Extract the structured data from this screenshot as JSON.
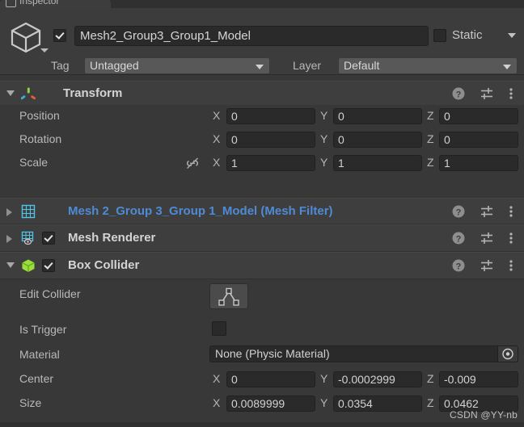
{
  "window": {
    "tab_label": "Inspector",
    "tab_icon": "inspector-icon"
  },
  "header": {
    "object_icon": "gameobject-cube-icon",
    "enabled_checkbox": true,
    "name": "Mesh2_Group3_Group1_Model",
    "static_label": "Static",
    "static_checked": false,
    "static_dropdown_icon": "chevron-down-icon",
    "tag_label": "Tag",
    "tag_value": "Untagged",
    "layer_label": "Layer",
    "layer_value": "Default"
  },
  "components": [
    {
      "name": "Transform",
      "icon": "transform-axis-icon",
      "expanded": true,
      "has_checkbox": false,
      "link": false,
      "rows": [
        {
          "label": "Position",
          "x": "0",
          "y": "0",
          "z": "0"
        },
        {
          "label": "Rotation",
          "x": "0",
          "y": "0",
          "z": "0"
        },
        {
          "label": "Scale",
          "x": "1",
          "y": "1",
          "z": "1",
          "constrain_icon": "link-off-icon"
        }
      ]
    },
    {
      "name": "Mesh 2_Group 3_Group 1_Model (Mesh Filter)",
      "icon": "mesh-filter-grid-icon",
      "expanded": false,
      "has_checkbox": false,
      "link": true
    },
    {
      "name": "Mesh Renderer",
      "icon": "mesh-renderer-icon",
      "expanded": false,
      "has_checkbox": true,
      "checked": true,
      "link": false
    },
    {
      "name": "Box Collider",
      "icon": "box-collider-cube-icon",
      "expanded": true,
      "has_checkbox": true,
      "checked": true,
      "link": false
    }
  ],
  "box_collider": {
    "edit_collider_label": "Edit Collider",
    "edit_collider_icon": "edit-collider-icon",
    "is_trigger_label": "Is Trigger",
    "is_trigger_checked": false,
    "material_label": "Material",
    "material_value": "None (Physic Material)",
    "material_picker_icon": "object-picker-icon",
    "center_label": "Center",
    "center": {
      "x": "0",
      "y": "-0.0002999",
      "z": "-0.009"
    },
    "size_label": "Size",
    "size": {
      "x": "0.0089999",
      "y": "0.0354",
      "z": "0.0462"
    }
  },
  "axis_labels": {
    "x": "X",
    "y": "Y",
    "z": "Z"
  },
  "header_icons": {
    "help": "help-icon",
    "preset": "preset-sliders-icon",
    "menu": "kebab-menu-icon"
  },
  "watermark": "CSDN @YY-nb",
  "colors": {
    "panel": "#383838",
    "comp_header": "#3e3e3e",
    "field": "#2a2a2a",
    "link_blue": "#4f8bd4",
    "collider_green": "#9ade3c",
    "mesh_cyan": "#4fc3e8",
    "axis_green": "#8fd13f",
    "axis_red": "#e05c3a",
    "axis_blue": "#3fa9d1"
  }
}
